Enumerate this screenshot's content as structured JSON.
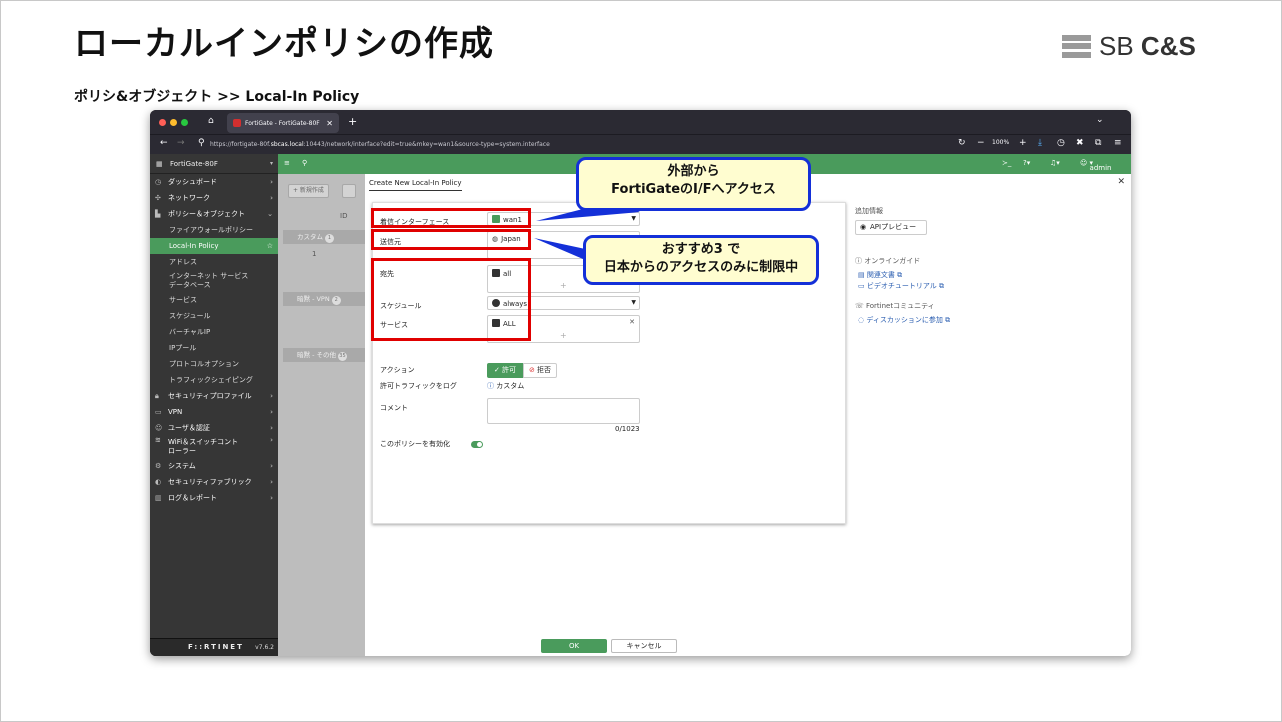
{
  "slide": {
    "title": "ローカルインポリシの作成",
    "breadcrumb": "ポリシ&オブジェクト >> Local-In Policy",
    "logo": {
      "text_prefix": "SB ",
      "text_bold": "C&S"
    }
  },
  "browser": {
    "tab_title": "FortiGate - FortiGate-80F",
    "url_prefix": "https://fortigate-80f.",
    "url_host": "sbcas.local",
    "url_suffix": ":10443/network/interface?edit=true&mkey=wan1&source-type=system.interface",
    "zoom": "100%"
  },
  "sidebar": {
    "device": "FortiGate-80F",
    "items": [
      {
        "label": "ダッシュボード",
        "icon": "dashboard-icon",
        "glyph": "◷",
        "chev": "›"
      },
      {
        "label": "ネットワーク",
        "icon": "network-icon",
        "glyph": "✣",
        "chev": "›"
      },
      {
        "label": "ポリシー＆オブジェクト",
        "icon": "policy-icon",
        "glyph": "▙",
        "chev": "⌄"
      },
      {
        "label": "ファイアウォールポリシー",
        "sub": true
      },
      {
        "label": "Local-In Policy",
        "sub": true,
        "active": true,
        "star": "☆"
      },
      {
        "label": "アドレス",
        "sub": true
      },
      {
        "label": "インターネット サービス\nデータベース",
        "sub": true,
        "two": true
      },
      {
        "label": "サービス",
        "sub": true
      },
      {
        "label": "スケジュール",
        "sub": true
      },
      {
        "label": "バーチャルIP",
        "sub": true
      },
      {
        "label": "IPプール",
        "sub": true
      },
      {
        "label": "プロトコルオプション",
        "sub": true
      },
      {
        "label": "トラフィックシェイピング",
        "sub": true
      },
      {
        "label": "セキュリティプロファイル",
        "icon": "lock-icon",
        "glyph": "🔒︎",
        "chev": "›"
      },
      {
        "label": "VPN",
        "icon": "vpn-icon",
        "glyph": "▭",
        "chev": "›"
      },
      {
        "label": "ユーザ＆認証",
        "icon": "user-icon",
        "glyph": "☺",
        "chev": "›"
      },
      {
        "label": "WiFi＆スイッチコント\nローラー",
        "icon": "wifi-icon",
        "glyph": "≋",
        "chev": "›",
        "two": true
      },
      {
        "label": "システム",
        "icon": "gear-icon",
        "glyph": "⚙",
        "chev": "›"
      },
      {
        "label": "セキュリティファブリック",
        "icon": "fabric-icon",
        "glyph": "◐",
        "chev": "›"
      },
      {
        "label": "ログ＆レポート",
        "icon": "chart-icon",
        "glyph": "▥",
        "chev": "›"
      }
    ],
    "brand": "F::RTINET",
    "version": "v7.6.2"
  },
  "topnav": {
    "user": "admin"
  },
  "background_list": {
    "new_button": "+ 新規作成",
    "id_header": "ID",
    "groups": [
      {
        "label": "カスタム",
        "count": "1"
      },
      {
        "label": "暗黙 - VPN",
        "count": "2"
      },
      {
        "label": "暗黙 - その他",
        "count": "35"
      }
    ],
    "row_id": "1"
  },
  "form": {
    "title": "Create New Local-In Policy",
    "fields": {
      "incoming_interface": {
        "label": "着信インターフェース",
        "value": "wan1"
      },
      "source": {
        "label": "送信元",
        "value": "Japan"
      },
      "destination": {
        "label": "宛先",
        "value": "all"
      },
      "schedule": {
        "label": "スケジュール",
        "value": "always"
      },
      "service": {
        "label": "サービス",
        "value": "ALL"
      },
      "action": {
        "label": "アクション",
        "allow": "許可",
        "deny": "拒否",
        "selected": "許可"
      },
      "log": {
        "label": "許可トラフィックをログ",
        "value": "カスタム"
      },
      "comment": {
        "label": "コメント",
        "counter": "0/1023"
      },
      "enable": {
        "label": "このポリシーを有効化",
        "enabled": true
      }
    },
    "plus": "+",
    "ok": "OK",
    "cancel": "キャンセル"
  },
  "side_panel": {
    "heading": "追加情報",
    "api_preview": "APIプレビュー",
    "online_guide": "オンラインガイド",
    "related_docs": "関連文書",
    "video_tutorial": "ビデオチュートリアル",
    "community": "Fortinetコミュニティ",
    "discussion": "ディスカッションに参加"
  },
  "callouts": {
    "interface": {
      "line1": "外部から",
      "line2": "FortiGateのI/Fへアクセス"
    },
    "source": {
      "line1": "おすすめ3 で",
      "line2": "日本からのアクセスのみに制限中"
    }
  },
  "colors": {
    "accent": "#4a9b5c",
    "highlight": "#e00000",
    "callout_border": "#1430d8",
    "callout_bg": "#fffdd0"
  }
}
